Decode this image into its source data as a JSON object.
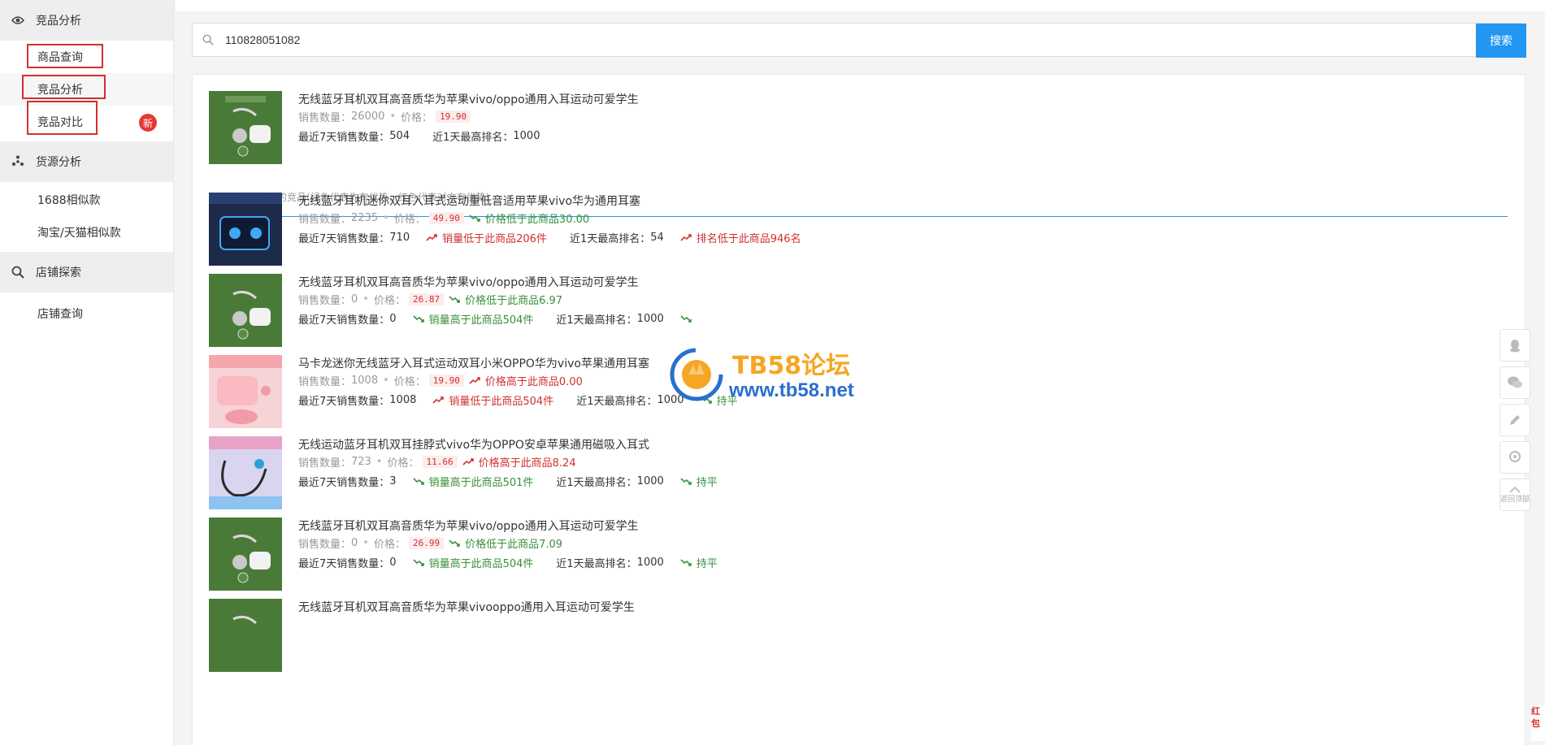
{
  "sidebar": {
    "groups": [
      {
        "title": "竞品分析",
        "icon": "eye-icon"
      },
      {
        "title": "货源分析",
        "icon": "pinwheel-icon"
      },
      {
        "title": "店铺探索",
        "icon": "search-icon"
      }
    ],
    "items": [
      {
        "label": "商品查询"
      },
      {
        "label": "竞品分析"
      },
      {
        "label": "竞品对比",
        "badge": "新"
      },
      {
        "label": "1688相似款"
      },
      {
        "label": "淘宝/天猫相似款"
      },
      {
        "label": "店铺查询"
      }
    ]
  },
  "search": {
    "value": "110828051082",
    "button": "搜索"
  },
  "base_product": {
    "title": "无线蓝牙耳机双耳高音质华为苹果vivo/oppo通用入耳运动可爱学生",
    "sales_label": "销售数量：",
    "sales": "26000",
    "price_label": "价格：",
    "price": "19.90",
    "sales7_label": "最近7天销售数量：",
    "sales7": "504",
    "rank_label": "近1天最高排名：",
    "rank": "1000"
  },
  "hint": "以下是为您探索的竞品(绿色代表你有优势，红色代表对方有优势)",
  "competitors": [
    {
      "title": "无线蓝牙耳机迷你双耳入耳式运动重低音适用苹果vivo华为通用耳塞",
      "sales": "2235",
      "price": "49.90",
      "price_cmp": "价格低于此商品30.00",
      "price_dir": "good",
      "sales7": "710",
      "sales_cmp": "销量低于此商品206件",
      "sales_dir": "bad",
      "rank": "54",
      "rank_cmp": "排名低于此商品946名",
      "rank_dir": "bad"
    },
    {
      "title": "无线蓝牙耳机双耳高音质华为苹果vivo/oppo通用入耳运动可爱学生",
      "sales": "0",
      "price": "26.87",
      "price_cmp": "价格低于此商品6.97",
      "price_dir": "good",
      "sales7": "0",
      "sales_cmp": "销量高于此商品504件",
      "sales_dir": "good",
      "rank": "1000",
      "rank_cmp": "",
      "rank_dir": "good"
    },
    {
      "title": "马卡龙迷你无线蓝牙入耳式运动双耳小米OPPO华为vivo苹果通用耳塞",
      "sales": "1008",
      "price": "19.90",
      "price_cmp": "价格高于此商品0.00",
      "price_dir": "bad",
      "sales7": "1008",
      "sales_cmp": "销量低于此商品504件",
      "sales_dir": "bad",
      "rank": "1000",
      "rank_cmp": "持平",
      "rank_dir": "good"
    },
    {
      "title": "无线运动蓝牙耳机双耳挂脖式vivo华为OPPO安卓苹果通用磁吸入耳式",
      "sales": "723",
      "price": "11.66",
      "price_cmp": "价格高于此商品8.24",
      "price_dir": "bad",
      "sales7": "3",
      "sales_cmp": "销量高于此商品501件",
      "sales_dir": "good",
      "rank": "1000",
      "rank_cmp": "持平",
      "rank_dir": "good"
    },
    {
      "title": "无线蓝牙耳机双耳高音质华为苹果vivo/oppo通用入耳运动可爱学生",
      "sales": "0",
      "price": "26.99",
      "price_cmp": "价格低于此商品7.09",
      "price_dir": "good",
      "sales7": "0",
      "sales_cmp": "销量高于此商品504件",
      "sales_dir": "good",
      "rank": "1000",
      "rank_cmp": "持平",
      "rank_dir": "good"
    },
    {
      "title": "无线蓝牙耳机双耳高音质华为苹果vivooppo通用入耳运动可爱学生"
    }
  ],
  "labels": {
    "sales": "销售数量：",
    "price": "价格：",
    "sales7": "最近7天销售数量：",
    "rank": "近1天最高排名："
  },
  "watermark": {
    "title": "TB58论坛",
    "url": "www.tb58.net"
  },
  "float_tools": [
    "penguin-icon",
    "chat-icon",
    "edit-icon",
    "location-icon",
    "back-to-top-icon"
  ],
  "float_tool_text": "返回顶部",
  "redpack": "红包",
  "colors": {
    "accent": "#2196f3",
    "good": "#3a8f3a",
    "bad": "#d0302f",
    "highlight": "#d32f2f"
  }
}
